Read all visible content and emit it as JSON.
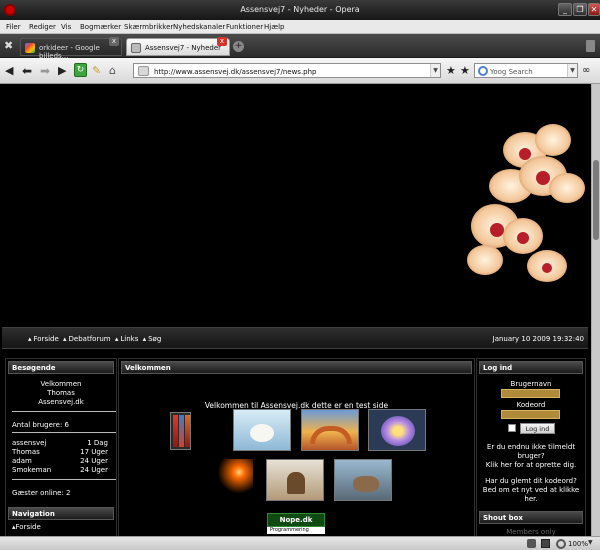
{
  "window": {
    "title": "Assensvej7 - Nyheder - Opera",
    "minimize": "_",
    "maximize": "❐",
    "close": "✕"
  },
  "menu": [
    "Filer",
    "Rediger",
    "Vis",
    "Bogmærker",
    "Skærmbrikker",
    "Nyhedskanaler",
    "Funktioner",
    "Hjælp"
  ],
  "tabs": [
    {
      "label": "orkideer - Google billeds...",
      "close": "x"
    },
    {
      "label": "Assensvej7 - Nyheder",
      "close": "x"
    }
  ],
  "toolbar": {
    "url": "http://www.assensvej.dk/assensvej7/news.php",
    "search_placeholder": "Yoog Search"
  },
  "nav": {
    "links": [
      "Forside",
      "Debatforum",
      "Links",
      "Søg"
    ],
    "datetime": "January 10 2009 19:32:40"
  },
  "left": {
    "visitors_title": "Besøgende",
    "welcome": [
      "Velkommen",
      "Thomas",
      "Assensvej.dk"
    ],
    "user_count": "Antal brugere: 6",
    "users": [
      {
        "name": "assensvej",
        "time": "1 Dag"
      },
      {
        "name": "Thomas",
        "time": "17 Uger"
      },
      {
        "name": "adam",
        "time": "24 Uger"
      },
      {
        "name": "Smokeman",
        "time": "24 Uger"
      }
    ],
    "guests": "Gæster online: 2",
    "navigation_title": "Navigation",
    "nav_first": "Forside"
  },
  "center": {
    "title": "Velkommen",
    "heading": "Velkommen til Assensvej.dk dette er en test side",
    "banner": "Nope.dk",
    "banner_sub": "Programmering"
  },
  "right": {
    "login_title": "Log ind",
    "username_label": "Brugernavn",
    "password_label": "Kodeord",
    "login_button": "Log ind",
    "register_text": [
      "Er du endnu ikke tilmeldt",
      "bruger?",
      "Klik her for at oprette dig."
    ],
    "forgot_text": [
      "Har du glemt dit kodeord?",
      "Bed om et nyt ved at klikke",
      "her."
    ],
    "shoutbox_title": "Shout box",
    "shoutbox_partial": "Members only"
  },
  "status": {
    "zoom": "100%"
  },
  "colors": {
    "accent": "#b08a39",
    "panel": "#1c1c1c",
    "brand_red": "#c00000"
  }
}
